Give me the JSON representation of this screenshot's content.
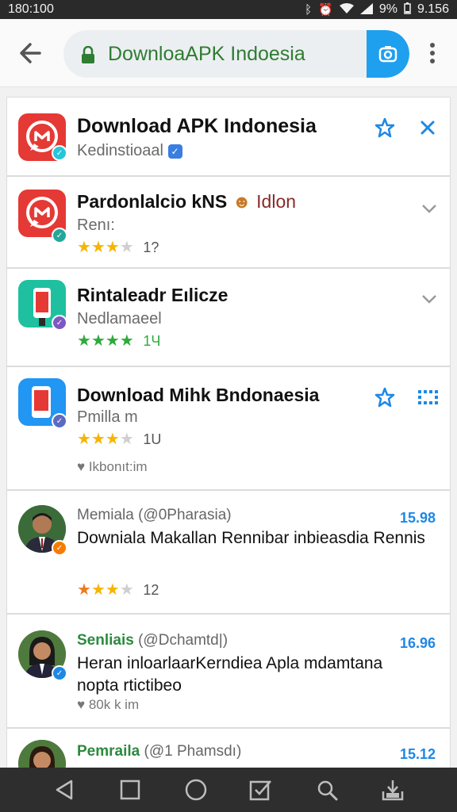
{
  "status_bar": {
    "time": "180:100",
    "battery": "9%",
    "clock_right": "9.156"
  },
  "search": {
    "text": "DownloaAPK Indoesia"
  },
  "cards": [
    {
      "title": "Download APK Indonesia",
      "subtitle": "Kedinstioaal",
      "action": "star-icon",
      "action2": "close-icon",
      "icon_color": "#e53935",
      "badge_color": "#26c6da"
    },
    {
      "title": "Pardonlalcio kNS",
      "title_extra": "Idlon",
      "subtitle": "Renı:",
      "rating": 3,
      "rating_count": "1?",
      "icon_color": "#e53935",
      "badge_color": "#26a69a"
    },
    {
      "title": "Rintaleadr Eılicze",
      "subtitle": "Nedlamaeel",
      "rating": 4,
      "rating_count": "1Ч",
      "icon_color": "#1ec0a0",
      "badge_color": "#7e57c2"
    },
    {
      "title": "Download Mihk Bndonaesia",
      "subtitle": "Pmilla m",
      "rating": 3,
      "rating_count": "1U",
      "meta": "Ikbonıt:im",
      "icon_color": "#2196f3",
      "badge_color": "#5c6bc0"
    }
  ],
  "posts": [
    {
      "name": "Memiala",
      "handle": "(@0Pharasia)",
      "price": "15.98",
      "text": "Downiala Makallan Rennibar inbieasdia Rennis",
      "rating": 3,
      "rating_count": "12",
      "badge_color": "#f57c00"
    },
    {
      "name": "Senliais",
      "handle": "(@Dchamtd|)",
      "price": "16.96",
      "text": "Heran inloarlaarKerndiea Apla mdamtana nopta rtictibeo",
      "meta": "80k k im",
      "badge_color": "#1e88e5"
    },
    {
      "name": "Pemraila",
      "handle": "(@1 Phamsdı)",
      "price": "15.12"
    }
  ]
}
